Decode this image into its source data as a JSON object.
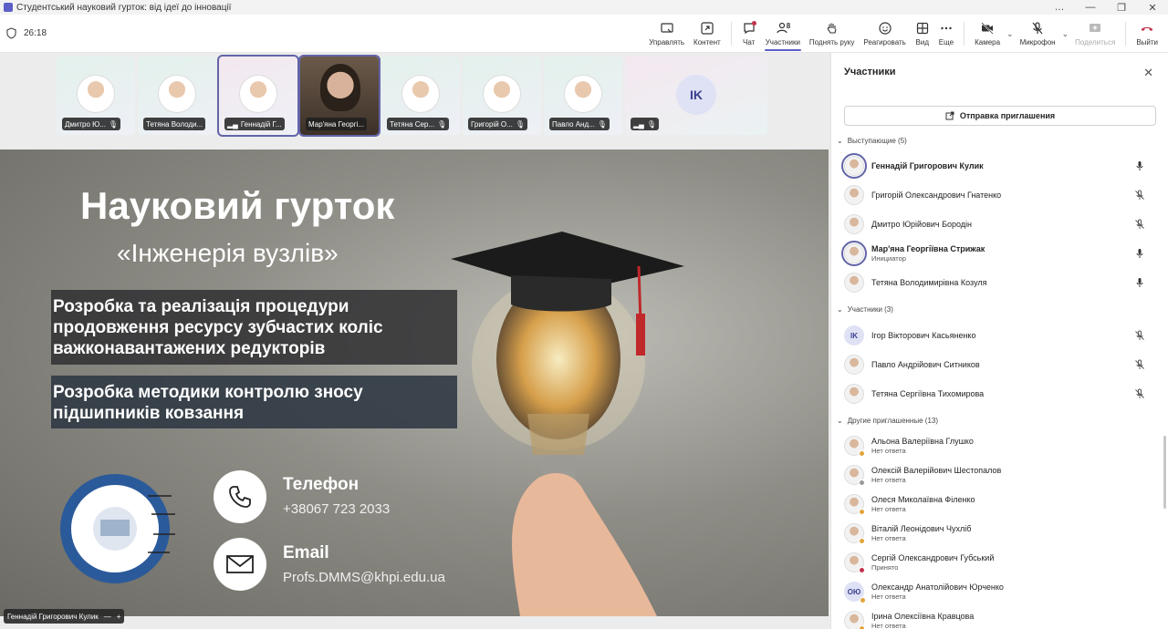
{
  "window": {
    "title": "Студентський науковий гурток: від ідеї до інновації",
    "controls": [
      "…",
      "—",
      "❐",
      "✕"
    ]
  },
  "toolbar": {
    "timer": "26:18",
    "buttons": {
      "share_tray": "Управлять",
      "content": "Контент",
      "chat": "Чат",
      "participants": "Участники",
      "participants_count": "8",
      "raise_hand": "Поднять руку",
      "react": "Реагировать",
      "view": "Вид",
      "more": "Еще",
      "camera": "Камера",
      "mic": "Микрофон",
      "share": "Поделиться",
      "leave": "Выйти"
    }
  },
  "tiles": [
    {
      "name": "Дмитро Ю..."
    },
    {
      "name": "Тетяна Володи..."
    },
    {
      "name": "Геннадій Г..."
    },
    {
      "name": "Мар'яна Георгі..."
    },
    {
      "name": "Тетяна Сер..."
    },
    {
      "name": "Григорій О..."
    },
    {
      "name": "Павло Анд..."
    },
    {
      "name": "",
      "initials": "IK"
    }
  ],
  "slide": {
    "title": "Науковий гурток",
    "subtitle": "«Інженерія вузлів»",
    "box1": "Розробка та реалізація процедури продовження ресурсу зубчастих коліс важконавантажених редукторів",
    "box2": "Розробка методики контролю зносу підшипників ковзання",
    "phone_label": "Телефон",
    "phone_value": "+38067 723 2033",
    "email_label": "Email",
    "email_value": "Profs.DMMS@khpi.edu.ua",
    "logo_text": "ДЕТАЛІ МАШИН ТА ГІДРОПНЕВМОСИСТЕМИ"
  },
  "presenter_tag": {
    "name": "Геннадій Григорович Кулик",
    "minus": "—",
    "plus": "+"
  },
  "panel": {
    "title": "Участники",
    "close": "✕",
    "invite_button": "Отправка приглашения",
    "sections": {
      "presenters": "Выступающие (5)",
      "attendees": "Участники (3)",
      "others": "Другие приглашенные (13)"
    },
    "presenters": [
      {
        "name": "Геннадій Григорович Кулик",
        "role": "",
        "mic": "on"
      },
      {
        "name": "Григорій Олександрович Гнатенко",
        "role": "",
        "mic": "off"
      },
      {
        "name": "Дмитро Юрійович Бородін",
        "role": "",
        "mic": "off"
      },
      {
        "name": "Мар'яна Георгіївна Стрижак",
        "role": "Инициатор",
        "mic": "on"
      },
      {
        "name": "Тетяна Володимирівна Козуля",
        "role": "",
        "mic": "on"
      }
    ],
    "attendees": [
      {
        "name": "Ігор Вікторович Касьяненко",
        "initials": "IK",
        "mic": "off"
      },
      {
        "name": "Павло Андрійович Ситников",
        "mic": "off"
      },
      {
        "name": "Тетяна Сергіївна Тихомирова",
        "mic": "off"
      }
    ],
    "others": [
      {
        "name": "Альона Валеріївна Глушко",
        "status": "Нет ответа"
      },
      {
        "name": "Олексій Валерійович Шестопалов",
        "status": "Нет ответа"
      },
      {
        "name": "Олеся Миколаївна Філенко",
        "status": "Нет ответа"
      },
      {
        "name": "Віталій Леонідович Чухліб",
        "status": "Нет ответа"
      },
      {
        "name": "Сергій Олександрович Губський",
        "status": "Принято"
      },
      {
        "name": "Олександр Анатолійович Юрченко",
        "status": "Нет ответа",
        "initials": "ОЮ"
      },
      {
        "name": "Ірина Олексіївна Кравцова",
        "status": "Нет ответа"
      }
    ]
  },
  "colors": {
    "accent": "#6264a7",
    "leave": "#c4314b",
    "status_pending": "#e2a43a"
  }
}
